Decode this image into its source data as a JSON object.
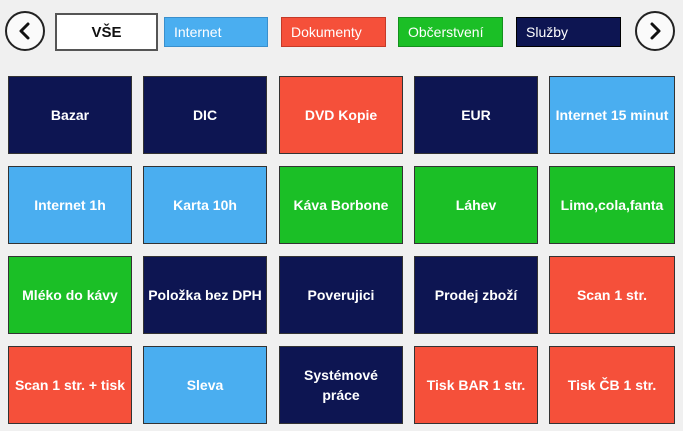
{
  "navigation": {
    "prev_icon": "chevron-left-icon",
    "next_icon": "chevron-right-icon"
  },
  "categories": [
    {
      "label": "VŠE",
      "color": "#ffffff"
    },
    {
      "label": "Internet",
      "color": "#4aaef0"
    },
    {
      "label": "Dokumenty",
      "color": "#f5503a"
    },
    {
      "label": "Občerstvení",
      "color": "#1bbf26"
    },
    {
      "label": "Služby",
      "color": "#0d1552"
    }
  ],
  "tiles": [
    {
      "label": "Bazar",
      "color": "#0d1552"
    },
    {
      "label": "DIC",
      "color": "#0d1552"
    },
    {
      "label": "DVD Kopie",
      "color": "#f5503a"
    },
    {
      "label": "EUR",
      "color": "#0d1552"
    },
    {
      "label": "Internet 15 minut",
      "color": "#4aaef0"
    },
    {
      "label": "Internet 1h",
      "color": "#4aaef0"
    },
    {
      "label": "Karta 10h",
      "color": "#4aaef0"
    },
    {
      "label": "Káva Borbone",
      "color": "#1bbf26"
    },
    {
      "label": "Láhev",
      "color": "#1bbf26"
    },
    {
      "label": "Limo,cola,fanta",
      "color": "#1bbf26"
    },
    {
      "label": "Mléko do kávy",
      "color": "#1bbf26"
    },
    {
      "label": "Položka bez DPH",
      "color": "#0d1552"
    },
    {
      "label": "Poverujici",
      "color": "#0d1552"
    },
    {
      "label": "Prodej zboží",
      "color": "#0d1552"
    },
    {
      "label": "Scan 1 str.",
      "color": "#f5503a"
    },
    {
      "label": "Scan 1 str. + tisk",
      "color": "#f5503a"
    },
    {
      "label": "Sleva",
      "color": "#4aaef0"
    },
    {
      "label": "Systémové práce",
      "color": "#0d1552"
    },
    {
      "label": "Tisk BAR 1 str.",
      "color": "#f5503a"
    },
    {
      "label": "Tisk ČB 1 str.",
      "color": "#f5503a"
    }
  ]
}
